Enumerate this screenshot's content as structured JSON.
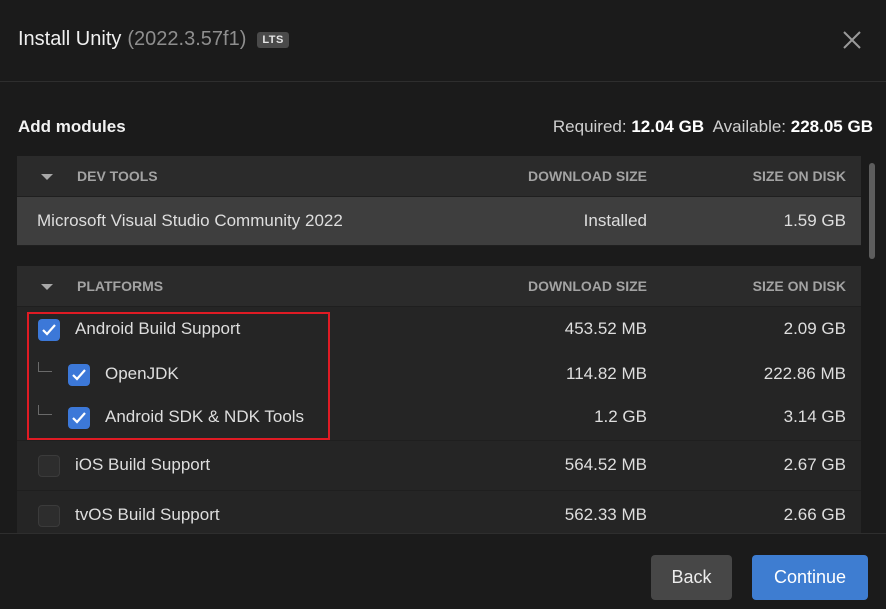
{
  "header": {
    "title": "Install Unity",
    "version": "(2022.3.57f1)",
    "badge": "LTS"
  },
  "summary": {
    "heading": "Add modules",
    "required_label": "Required:",
    "required_value": "12.04 GB",
    "available_label": "Available:",
    "available_value": "228.05 GB"
  },
  "sections": [
    {
      "name": "DEV TOOLS",
      "col_download": "DOWNLOAD SIZE",
      "col_disk": "SIZE ON DISK",
      "rows": [
        {
          "label": "Microsoft Visual Studio Community 2022",
          "download": "Installed",
          "disk": "1.59 GB"
        }
      ]
    },
    {
      "name": "PLATFORMS",
      "col_download": "DOWNLOAD SIZE",
      "col_disk": "SIZE ON DISK",
      "rows": [
        {
          "label": "Android Build Support",
          "download": "453.52 MB",
          "disk": "2.09 GB",
          "checked": true
        },
        {
          "label": "OpenJDK",
          "download": "114.82 MB",
          "disk": "222.86 MB",
          "checked": true,
          "child": true
        },
        {
          "label": "Android SDK & NDK Tools",
          "download": "1.2 GB",
          "disk": "3.14 GB",
          "checked": true,
          "child": true
        },
        {
          "label": "iOS Build Support",
          "download": "564.52 MB",
          "disk": "2.67 GB",
          "checked": false
        },
        {
          "label": "tvOS Build Support",
          "download": "562.33 MB",
          "disk": "2.66 GB",
          "checked": false
        }
      ]
    }
  ],
  "footer": {
    "back_label": "Back",
    "continue_label": "Continue"
  },
  "icons": {
    "close": "close-icon",
    "caret": "chevron-down-icon",
    "check": "checkmark-icon"
  },
  "colors": {
    "accent": "#3e7dd1",
    "checkbox": "#3c78d8",
    "highlight": "#e01b24"
  }
}
